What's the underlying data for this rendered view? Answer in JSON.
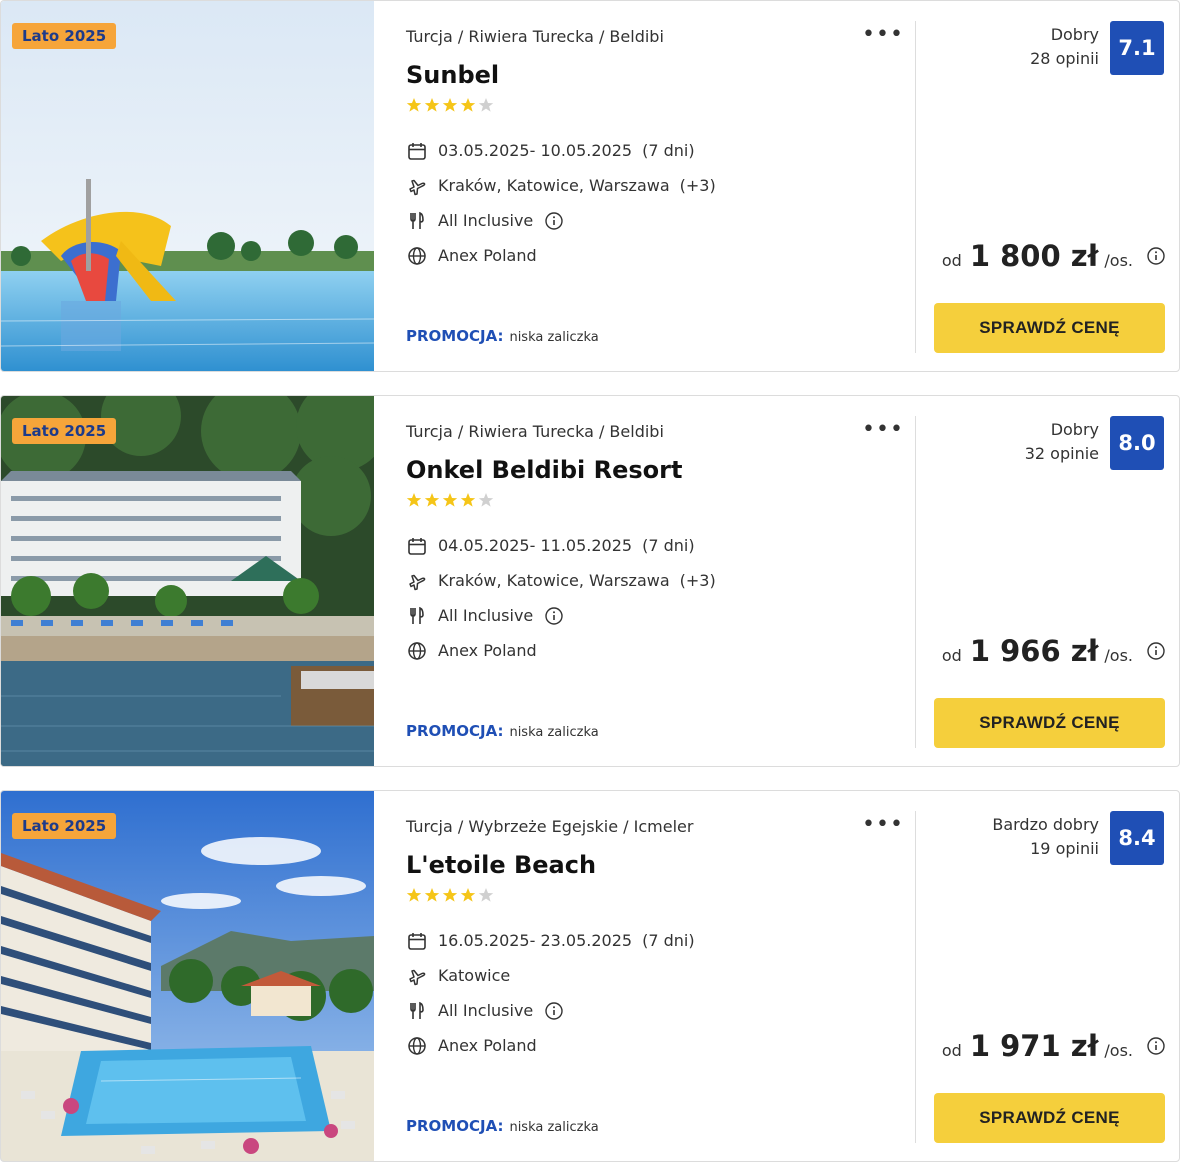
{
  "offers": [
    {
      "season_badge": "Lato 2025",
      "breadcrumb": "Turcja / Riwiera Turecka / Beldibi",
      "name": "Sunbel",
      "stars": 4,
      "dates": "03.05.2025- 10.05.2025",
      "duration": "(7 dni)",
      "departure": "Kraków, Katowice, Warszawa",
      "departure_extra": "(+3)",
      "board": "All Inclusive",
      "operator": "Anex Poland",
      "promo_label": "PROMOCJA:",
      "promo_text": "niska zaliczka",
      "rating_label": "Dobry",
      "reviews": "28 opinii",
      "rating": "7.1",
      "price_prefix": "od",
      "price": "1 800 zł",
      "price_suffix": "/os.",
      "cta": "SPRAWDŹ CENĘ",
      "photo": "pool-waterslide"
    },
    {
      "season_badge": "Lato 2025",
      "breadcrumb": "Turcja / Riwiera Turecka / Beldibi",
      "name": "Onkel Beldibi Resort",
      "stars": 4,
      "dates": "04.05.2025- 11.05.2025",
      "duration": "(7 dni)",
      "departure": "Kraków, Katowice, Warszawa",
      "departure_extra": "(+3)",
      "board": "All Inclusive",
      "operator": "Anex Poland",
      "promo_label": "PROMOCJA:",
      "promo_text": "niska zaliczka",
      "rating_label": "Dobry",
      "reviews": "32 opinie",
      "rating": "8.0",
      "price_prefix": "od",
      "price": "1 966 zł",
      "price_suffix": "/os.",
      "cta": "SPRAWDŹ CENĘ",
      "photo": "resort-seaside"
    },
    {
      "season_badge": "Lato 2025",
      "breadcrumb": "Turcja / Wybrzeże Egejskie / Icmeler",
      "name": "L'etoile Beach",
      "stars": 4,
      "dates": "16.05.2025- 23.05.2025",
      "duration": "(7 dni)",
      "departure": "Katowice",
      "departure_extra": "",
      "board": "All Inclusive",
      "operator": "Anex Poland",
      "promo_label": "PROMOCJA:",
      "promo_text": "niska zaliczka",
      "rating_label": "Bardzo dobry",
      "reviews": "19 opinii",
      "rating": "8.4",
      "price_prefix": "od",
      "price": "1 971 zł",
      "price_suffix": "/os.",
      "cta": "SPRAWDŹ CENĘ",
      "photo": "hotel-pool-mountains"
    }
  ],
  "colors": {
    "badge_bg": "#f6a53a",
    "badge_text": "#1e3b8a",
    "rating_bg": "#1f4fb5",
    "cta_bg": "#f5cf3c",
    "promo_label": "#1f4fb5",
    "star_on": "#f5c518",
    "star_off": "#d0d0d0"
  },
  "icons": {
    "favorite": "heart-icon",
    "more": "more-dots-icon",
    "dates": "calendar-icon",
    "departure": "airplane-icon",
    "board": "cutlery-icon",
    "operator": "globe-icon",
    "info": "info-icon"
  }
}
